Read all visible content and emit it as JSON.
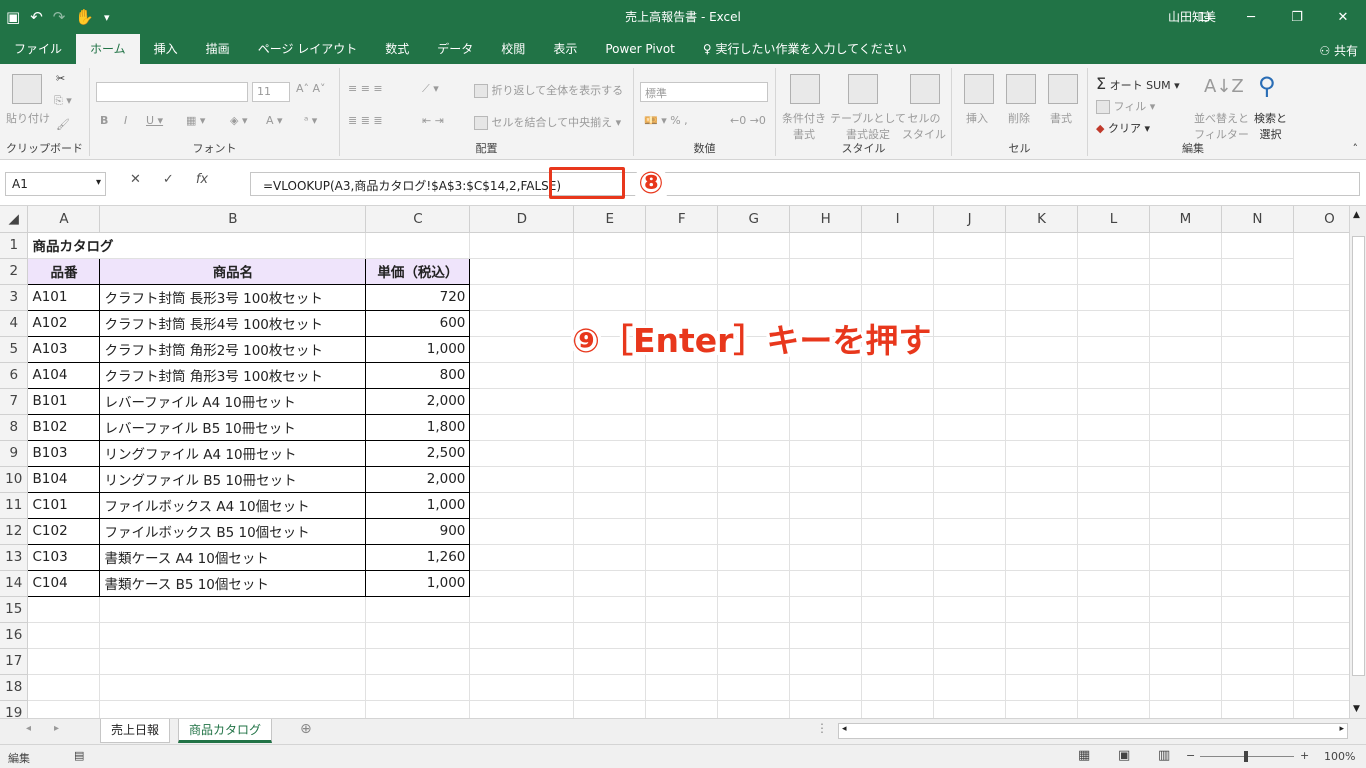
{
  "window": {
    "title": "売上高報告書  -  Excel",
    "user": "山田知美"
  },
  "ribbon_tabs": [
    "ファイル",
    "ホーム",
    "挿入",
    "描画",
    "ページ レイアウト",
    "数式",
    "データ",
    "校閲",
    "表示",
    "Power Pivot",
    "♀ 実行したい作業を入力してください"
  ],
  "active_tab": "ホーム",
  "share_label": "共有",
  "ribbon": {
    "clipboard": {
      "paste": "貼り付け",
      "label": "クリップボード"
    },
    "font": {
      "size": "11",
      "label": "フォント"
    },
    "alignment": {
      "wrap": "折り返して全体を表示する",
      "merge": "セルを結合して中央揃え",
      "label": "配置"
    },
    "number": {
      "format": "標準",
      "label": "数値"
    },
    "styles": {
      "cond": "条件付き\n書式",
      "table": "テーブルとして\n書式設定",
      "cell": "セルの\nスタイル",
      "label": "スタイル"
    },
    "cells": {
      "insert": "挿入",
      "delete": "削除",
      "format": "書式",
      "label": "セル"
    },
    "editing": {
      "autosum": "オート SUM",
      "fill": "フィル",
      "clear": "クリア",
      "sort": "並べ替えと\nフィルター",
      "find": "検索と\n選択",
      "label": "編集"
    }
  },
  "formula_bar": {
    "name_box": "A1",
    "formula": "=VLOOKUP(A3,商品カタログ!$A$3:$C$14,2,FALSE)"
  },
  "annotations": {
    "step8": "⑧",
    "step9": "⑨［Enter］キーを押す"
  },
  "columns": [
    "A",
    "B",
    "C",
    "D",
    "E",
    "F",
    "G",
    "H",
    "I",
    "J",
    "K",
    "L",
    "M",
    "N",
    "O"
  ],
  "rows": [
    "1",
    "2",
    "3",
    "4",
    "5",
    "6",
    "7",
    "8",
    "9",
    "10",
    "11",
    "12",
    "13",
    "14",
    "15",
    "16",
    "17",
    "18",
    "19"
  ],
  "sheet": {
    "title": "商品カタログ",
    "headers": [
      "品番",
      "商品名",
      "単価（税込）"
    ],
    "items": [
      [
        "A101",
        "クラフト封筒 長形3号 100枚セット",
        "720"
      ],
      [
        "A102",
        "クラフト封筒 長形4号 100枚セット",
        "600"
      ],
      [
        "A103",
        "クラフト封筒 角形2号 100枚セット",
        "1,000"
      ],
      [
        "A104",
        "クラフト封筒 角形3号 100枚セット",
        "800"
      ],
      [
        "B101",
        "レバーファイル A4 10冊セット",
        "2,000"
      ],
      [
        "B102",
        "レバーファイル B5 10冊セット",
        "1,800"
      ],
      [
        "B103",
        "リングファイル A4 10冊セット",
        "2,500"
      ],
      [
        "B104",
        "リングファイル B5 10冊セット",
        "2,000"
      ],
      [
        "C101",
        "ファイルボックス A4 10個セット",
        "1,000"
      ],
      [
        "C102",
        "ファイルボックス B5 10個セット",
        "900"
      ],
      [
        "C103",
        "書類ケース A4 10個セット",
        "1,260"
      ],
      [
        "C104",
        "書類ケース B5 10個セット",
        "1,000"
      ]
    ]
  },
  "sheet_tabs": [
    "売上日報",
    "商品カタログ"
  ],
  "active_sheet": "商品カタログ",
  "status": {
    "mode": "編集",
    "zoom": "100%"
  },
  "colors": {
    "accent": "#217346",
    "annotation": "#e8371c",
    "header_fill": "#efe4fb"
  }
}
